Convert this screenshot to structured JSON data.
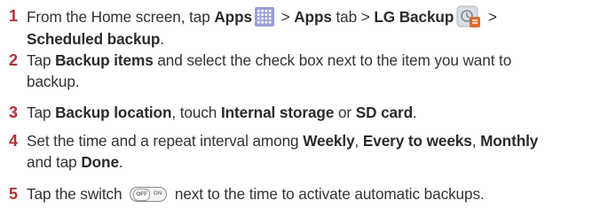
{
  "steps": [
    {
      "number": "1",
      "line1": [
        {
          "t": "From the Home screen, tap "
        },
        {
          "b": "Apps"
        },
        {
          "icon": "apps-grid-icon"
        },
        {
          "t": " > "
        },
        {
          "b": "Apps"
        },
        {
          "t": " tab > "
        },
        {
          "b": "LG Backup"
        },
        {
          "icon": "lg-backup-icon"
        },
        {
          "t": " >"
        }
      ],
      "line2": [
        {
          "b": "Scheduled backup"
        },
        {
          "t": "."
        }
      ]
    },
    {
      "number": "2",
      "line1": [
        {
          "t": "Tap "
        },
        {
          "b": "Backup items"
        },
        {
          "t": " and select the check box next to the item you want to"
        }
      ],
      "line2": [
        {
          "t": "backup."
        }
      ]
    },
    {
      "number": "3",
      "line1": [
        {
          "t": "Tap "
        },
        {
          "b": "Backup location"
        },
        {
          "t": ", touch "
        },
        {
          "b": "Internal storage"
        },
        {
          "t": " or "
        },
        {
          "b": "SD card"
        },
        {
          "t": "."
        }
      ]
    },
    {
      "number": "4",
      "line1": [
        {
          "t": "Set the time and a repeat interval among "
        },
        {
          "b": "Weekly"
        },
        {
          "t": ", "
        },
        {
          "b": "Every to weeks"
        },
        {
          "t": ", "
        },
        {
          "b": "Monthly"
        }
      ],
      "line2": [
        {
          "t": "and tap "
        },
        {
          "b": "Done"
        },
        {
          "t": "."
        }
      ]
    },
    {
      "number": "5",
      "line1": [
        {
          "t": "Tap the switch "
        },
        {
          "icon": "off-on-switch-icon"
        },
        {
          "t": " next to the time to activate automatic backups."
        }
      ]
    }
  ],
  "switch_icon": {
    "off_label": "OFF",
    "on_label": "ON"
  },
  "colors": {
    "step_number": "#b22f35",
    "text": "#333333",
    "apps_icon": "#9b9fd8",
    "backup_badge": "#e06a2c"
  }
}
